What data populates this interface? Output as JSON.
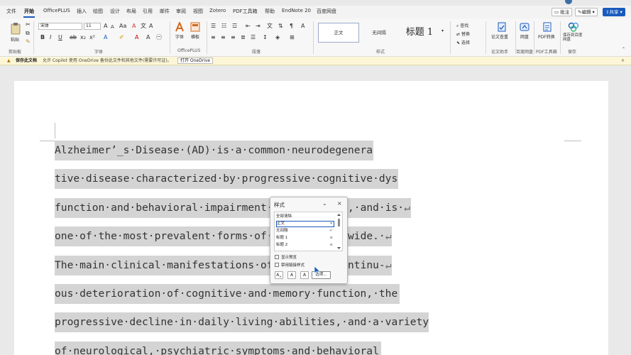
{
  "menu": {
    "tabs": [
      "文件",
      "开始",
      "OfficePLUS",
      "插入",
      "绘图",
      "设计",
      "布局",
      "引用",
      "邮件",
      "审阅",
      "视图",
      "Zotero",
      "PDF工具箱",
      "帮助",
      "EndNote 20",
      "百度网盘"
    ],
    "active_tab": "开始",
    "comments_label": "批注",
    "editing_label": "编辑",
    "share_label": "共享"
  },
  "ribbon": {
    "groups": {
      "clipboard": "剪贴板",
      "font": "字体",
      "officeplus": "OfficePLUS",
      "paragraph": "段落",
      "styles": "样式",
      "paper_check": "论文助手",
      "cloud": "百度网盘",
      "pdf": "PDF工具箱",
      "save": "保存"
    },
    "paste_label": "粘贴",
    "font_name": "宋体",
    "font_size": "11",
    "font_label": "字体",
    "layout_label": "横板",
    "styles": [
      "正文",
      "无间隔",
      "标题 1"
    ],
    "find_label": "查找",
    "replace_label": "替换",
    "select_label": "选择",
    "paper_label": "论文查重",
    "cloud_label": "网盘",
    "pdf_label": "PDF转换",
    "save_label": "保存到百度网盘"
  },
  "infobar": {
    "title": "保存此文档",
    "message": "允许 Copilot 使用 OneDrive 备份此文件和其他文件(需要许可证)。",
    "button": "打开 OneDrive"
  },
  "document": {
    "lines": [
      "Alzheimer’_s·Disease·(AD)·is·a·common·neurodegenera-",
      "tive·disease·characterized·by·progressive·cognitive·dys-",
      "function·and·behavioral·impairment·i",
      "one·of·the·most·prevalent·forms·of·d",
      "The·main·clinical·manifestations·of·",
      "ous·deterioration·of·cognitive·and·memory·function,·the·",
      "progressive·decline·in·daily·living·abilities,·and·a·variety·",
      "of·neurological,·psychiatric·symptoms·and·behavioral·"
    ],
    "line_tails": [
      "",
      "",
      ",·and·is·",
      "wide.·",
      "ntinu-",
      "",
      "",
      ""
    ],
    "para_mark": "↵"
  },
  "styles_pane": {
    "title": "样式",
    "items": [
      "全部清除",
      "正文",
      "无间隔",
      "标题 1",
      "标题 2"
    ],
    "selected": "正文",
    "show_preview": "显示预览",
    "disable_linked": "禁用链接样式",
    "options": "选项..."
  }
}
